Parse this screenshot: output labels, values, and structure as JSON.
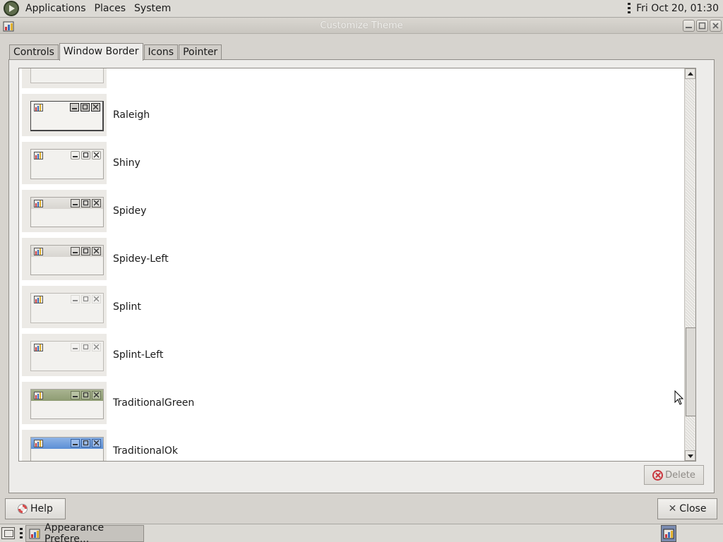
{
  "top_panel": {
    "menus": [
      "Applications",
      "Places",
      "System"
    ],
    "clock": "Fri Oct 20, 01:30"
  },
  "window": {
    "title": "Customize Theme"
  },
  "tabs": [
    {
      "label": "Controls",
      "active": false
    },
    {
      "label": "Window Border",
      "active": true
    },
    {
      "label": "Icons",
      "active": false
    },
    {
      "label": "Pointer",
      "active": false
    }
  ],
  "themes": [
    {
      "name": "",
      "style": "splint"
    },
    {
      "name": "Raleigh",
      "style": "raleigh"
    },
    {
      "name": "Shiny",
      "style": "shiny"
    },
    {
      "name": "Spidey",
      "style": "spidey"
    },
    {
      "name": "Spidey-Left",
      "style": "spidey"
    },
    {
      "name": "Splint",
      "style": "splint"
    },
    {
      "name": "Splint-Left",
      "style": "splint"
    },
    {
      "name": "TraditionalGreen",
      "style": "green"
    },
    {
      "name": "TraditionalOk",
      "style": "ok"
    }
  ],
  "scrollbar": {
    "position_fraction": 0.88,
    "visible_fraction": 0.24
  },
  "buttons": {
    "delete_label": "Delete",
    "help_label": "Help",
    "close_label": "Close"
  },
  "taskbar": {
    "window_item": "Appearance Prefere..."
  }
}
